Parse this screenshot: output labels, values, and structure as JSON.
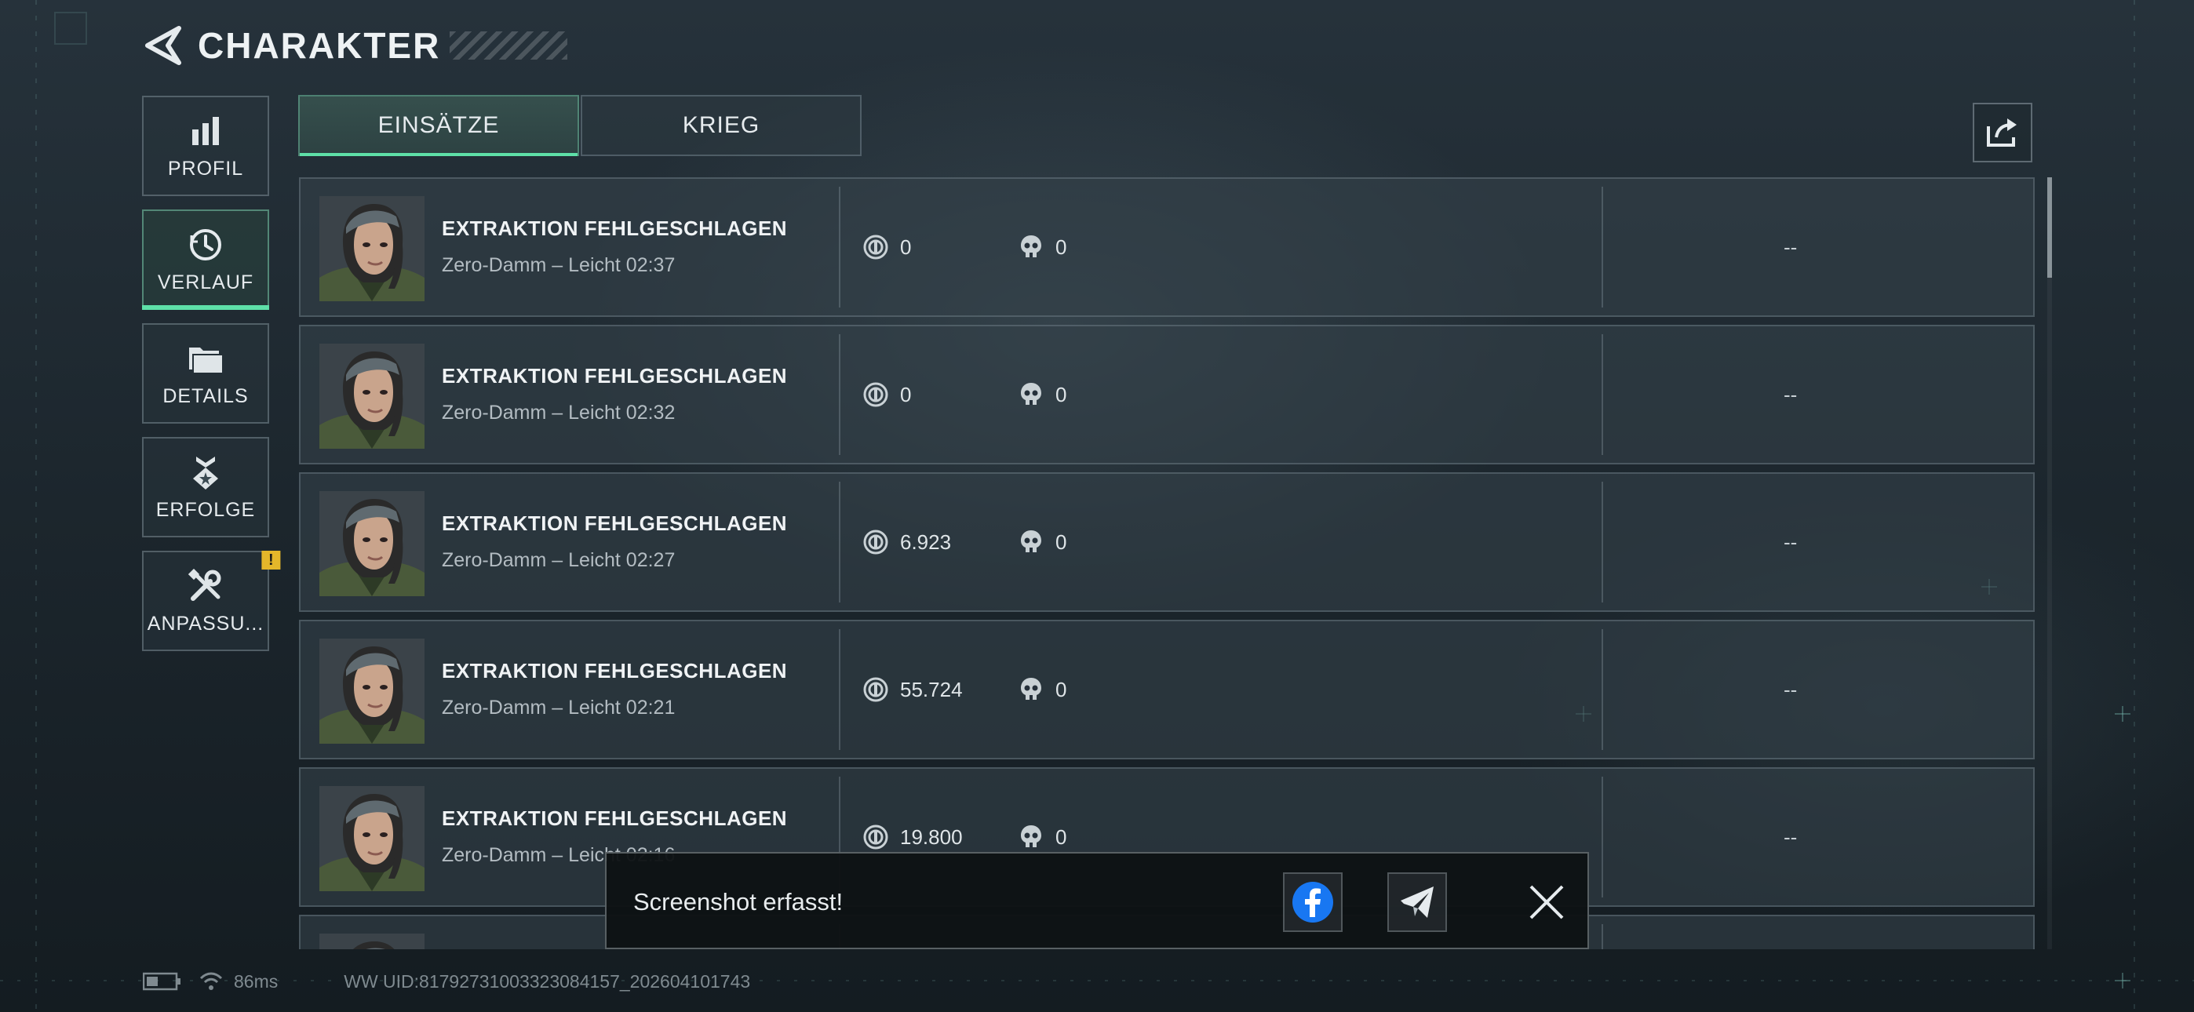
{
  "header": {
    "title": "CHARAKTER"
  },
  "sidebar": {
    "items": [
      {
        "label": "PROFIL",
        "icon": "bar-chart-icon"
      },
      {
        "label": "VERLAUF",
        "icon": "history-clock-icon",
        "active": true
      },
      {
        "label": "DETAILS",
        "icon": "folders-icon"
      },
      {
        "label": "ERFOLGE",
        "icon": "medal-icon"
      },
      {
        "label": "ANPASSU...",
        "icon": "tools-icon",
        "badge": "!"
      }
    ]
  },
  "tabs": [
    {
      "label": "EINSÄTZE",
      "active": true
    },
    {
      "label": "KRIEG",
      "active": false
    }
  ],
  "matches": [
    {
      "title": "EXTRAKTION FEHLGESCHLAGEN",
      "subtitle": "Zero-Damm – Leicht 02:37",
      "credits": "0",
      "kills": "0",
      "result": "--"
    },
    {
      "title": "EXTRAKTION FEHLGESCHLAGEN",
      "subtitle": "Zero-Damm – Leicht 02:32",
      "credits": "0",
      "kills": "0",
      "result": "--"
    },
    {
      "title": "EXTRAKTION FEHLGESCHLAGEN",
      "subtitle": "Zero-Damm – Leicht 02:27",
      "credits": "6.923",
      "kills": "0",
      "result": "--"
    },
    {
      "title": "EXTRAKTION FEHLGESCHLAGEN",
      "subtitle": "Zero-Damm – Leicht 02:21",
      "credits": "55.724",
      "kills": "0",
      "result": "--"
    },
    {
      "title": "EXTRAKTION FEHLGESCHLAGEN",
      "subtitle": "Zero-Damm – Leicht 02:16",
      "credits": "19.800",
      "kills": "0",
      "result": "--"
    }
  ],
  "toast": {
    "message": "Screenshot erfasst!"
  },
  "status": {
    "ping": "86ms",
    "uid": "WW UID:8179273100332308415​7_202604101743"
  },
  "colors": {
    "accent": "#5ee0a8",
    "badge": "#e4b62a",
    "facebook": "#1877f2"
  }
}
